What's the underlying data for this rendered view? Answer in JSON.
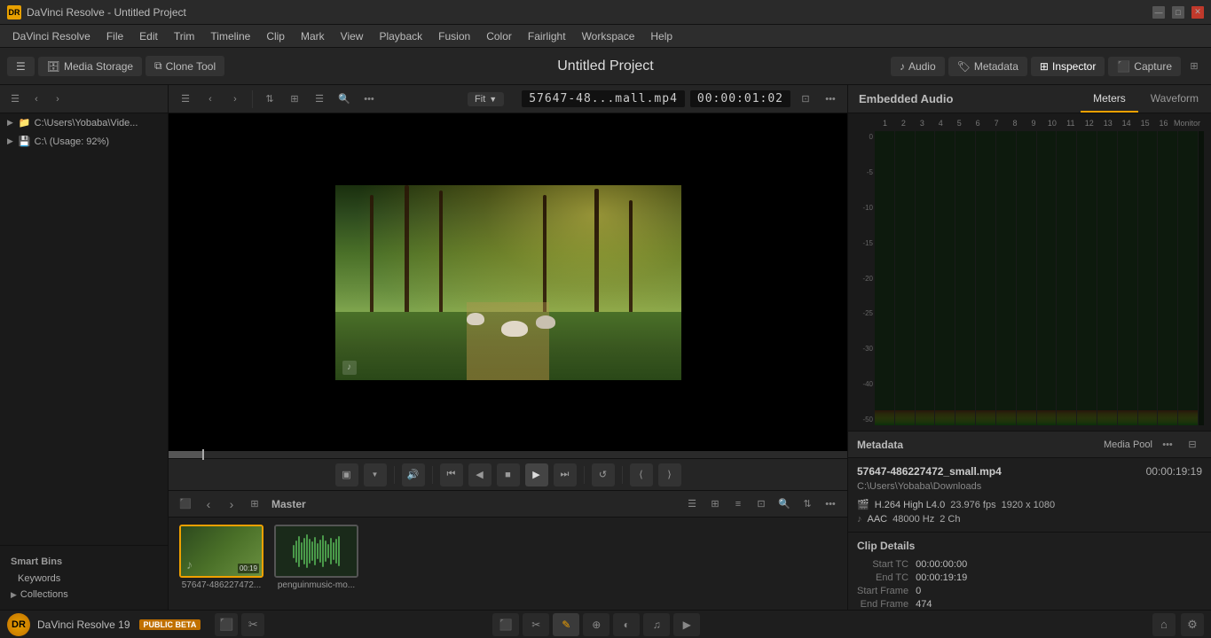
{
  "titlebar": {
    "icon": "DR",
    "title": "DaVinci Resolve - Untitled Project",
    "minimize": "—",
    "maximize": "□",
    "close": "✕"
  },
  "menubar": {
    "items": [
      "DaVinci Resolve",
      "File",
      "Edit",
      "Trim",
      "Timeline",
      "Clip",
      "Mark",
      "View",
      "Playback",
      "Fusion",
      "Color",
      "Fairlight",
      "Workspace",
      "Help"
    ]
  },
  "header": {
    "media_storage_label": "Media Storage",
    "clone_tool_label": "Clone Tool",
    "project_title": "Untitled Project",
    "audio_btn": "Audio",
    "metadata_btn": "Metadata",
    "inspector_btn": "Inspector",
    "capture_btn": "Capture"
  },
  "left_panel": {
    "tree_items": [
      {
        "label": "C:\\Users\\Yobaba\\Vide...",
        "type": "folder"
      },
      {
        "label": "C:\\ (Usage: 92%)",
        "type": "folder"
      }
    ],
    "master_label": "Master",
    "smart_bins_label": "Smart Bins",
    "keywords_label": "Keywords",
    "collections_label": "Collections"
  },
  "preview": {
    "filename": "57647-48...mall.mp4",
    "timecode": "00:00:01:02",
    "fit_label": "Fit",
    "controls": {
      "screen_icon": "▣",
      "volume_icon": "🔊",
      "go_start": "⏮",
      "prev_frame": "◀",
      "stop": "■",
      "play": "▶",
      "go_end": "⏭",
      "loop": "🔁",
      "mark_in": "⟨",
      "mark_out": "⟩"
    }
  },
  "media_pool": {
    "bin_label": "Master",
    "clips": [
      {
        "name": "57647-486227472...",
        "type": "video"
      },
      {
        "name": "penguinmusic-mo...",
        "type": "audio"
      }
    ]
  },
  "right_panel": {
    "embedded_audio_title": "Embedded Audio",
    "tabs": [
      "Meters",
      "Waveform"
    ],
    "active_tab": "Meters",
    "meter_numbers": [
      "1",
      "2",
      "3",
      "4",
      "5",
      "6",
      "7",
      "8",
      "9",
      "10",
      "11",
      "12",
      "13",
      "14",
      "15",
      "16"
    ],
    "monitor_label": "Monitor",
    "scale_labels": [
      "0",
      "-5",
      "-10",
      "-15",
      "-20",
      "-25",
      "-30",
      "-40",
      "-50"
    ]
  },
  "metadata": {
    "title": "Metadata",
    "media_pool_label": "Media Pool",
    "filename": "57647-486227472_small.mp4",
    "duration": "00:00:19:19",
    "path": "C:\\Users\\Yobaba\\Downloads",
    "video_codec": "H.264 High L4.0",
    "fps": "23.976 fps",
    "resolution": "1920 x 1080",
    "audio_codec": "AAC",
    "sample_rate": "48000 Hz",
    "channels": "2 Ch",
    "clip_details_title": "Clip Details",
    "start_tc_label": "Start TC",
    "start_tc_value": "00:00:00:00",
    "end_tc_label": "End TC",
    "end_tc_value": "00:00:19:19",
    "start_frame_label": "Start Frame",
    "start_frame_value": "0",
    "end_frame_label": "End Frame",
    "end_frame_value": "474"
  },
  "taskbar": {
    "logo": "DR",
    "app_name": "DaVinci Resolve 19",
    "badge": "PUBLIC BETA",
    "workspace_icons": [
      "⬛",
      "🎬",
      "≡",
      "⚙",
      "🎵"
    ],
    "right_icons": [
      "🔔",
      "⚙"
    ]
  }
}
